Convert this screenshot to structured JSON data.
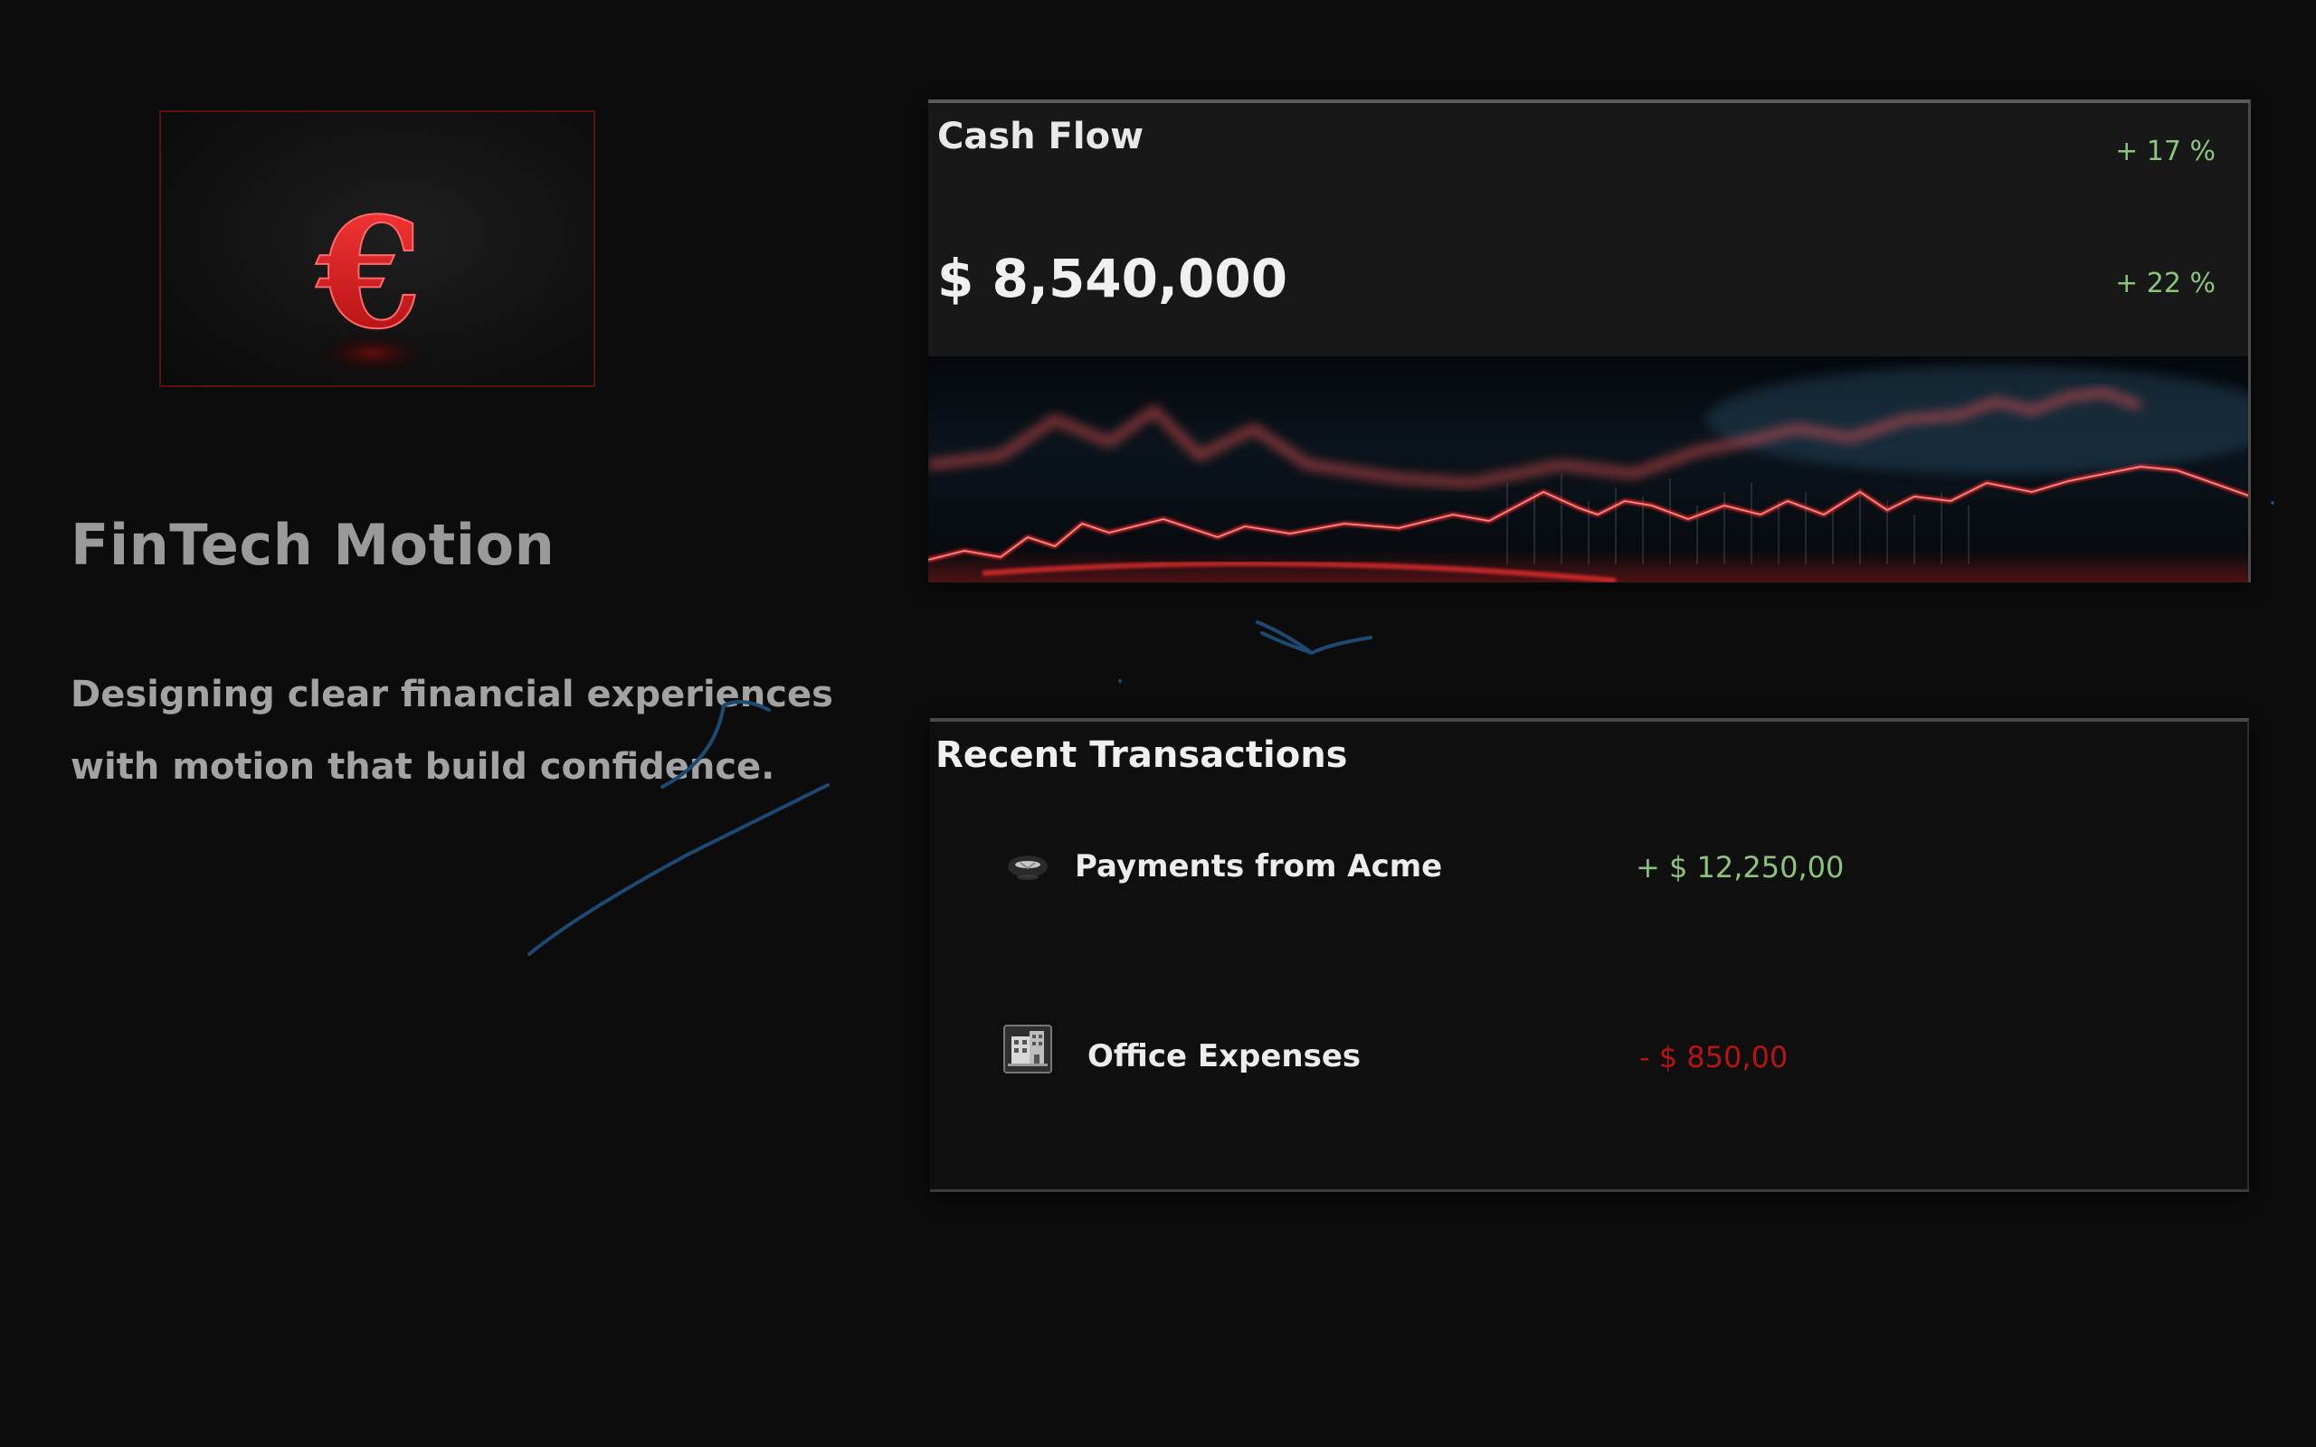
{
  "brand": {
    "title": "FinTech Motion",
    "tagline_line1": "Designing clear financial experiences",
    "tagline_line2": "with motion that build confidence.",
    "hero_icon": "euro-icon"
  },
  "cash_flow": {
    "title": "Cash Flow",
    "amount": "$ 8,540,000",
    "change_1": "+ 17 %",
    "change_2": "+ 22 %"
  },
  "transactions": {
    "title": "Recent Transactions",
    "items": [
      {
        "label": "Payments from Acme",
        "amount": "+ $ 12,250,00",
        "icon": "incoming-payment-icon"
      },
      {
        "label": "Office Expenses",
        "amount": "- $ 850,00",
        "icon": "office-building-icon"
      }
    ]
  },
  "colors": {
    "background": "#0c0c0c",
    "accent_red": "#e0282c",
    "positive": "#8bc47a",
    "negative": "#b81414",
    "doodle_blue": "#1d4a72"
  }
}
